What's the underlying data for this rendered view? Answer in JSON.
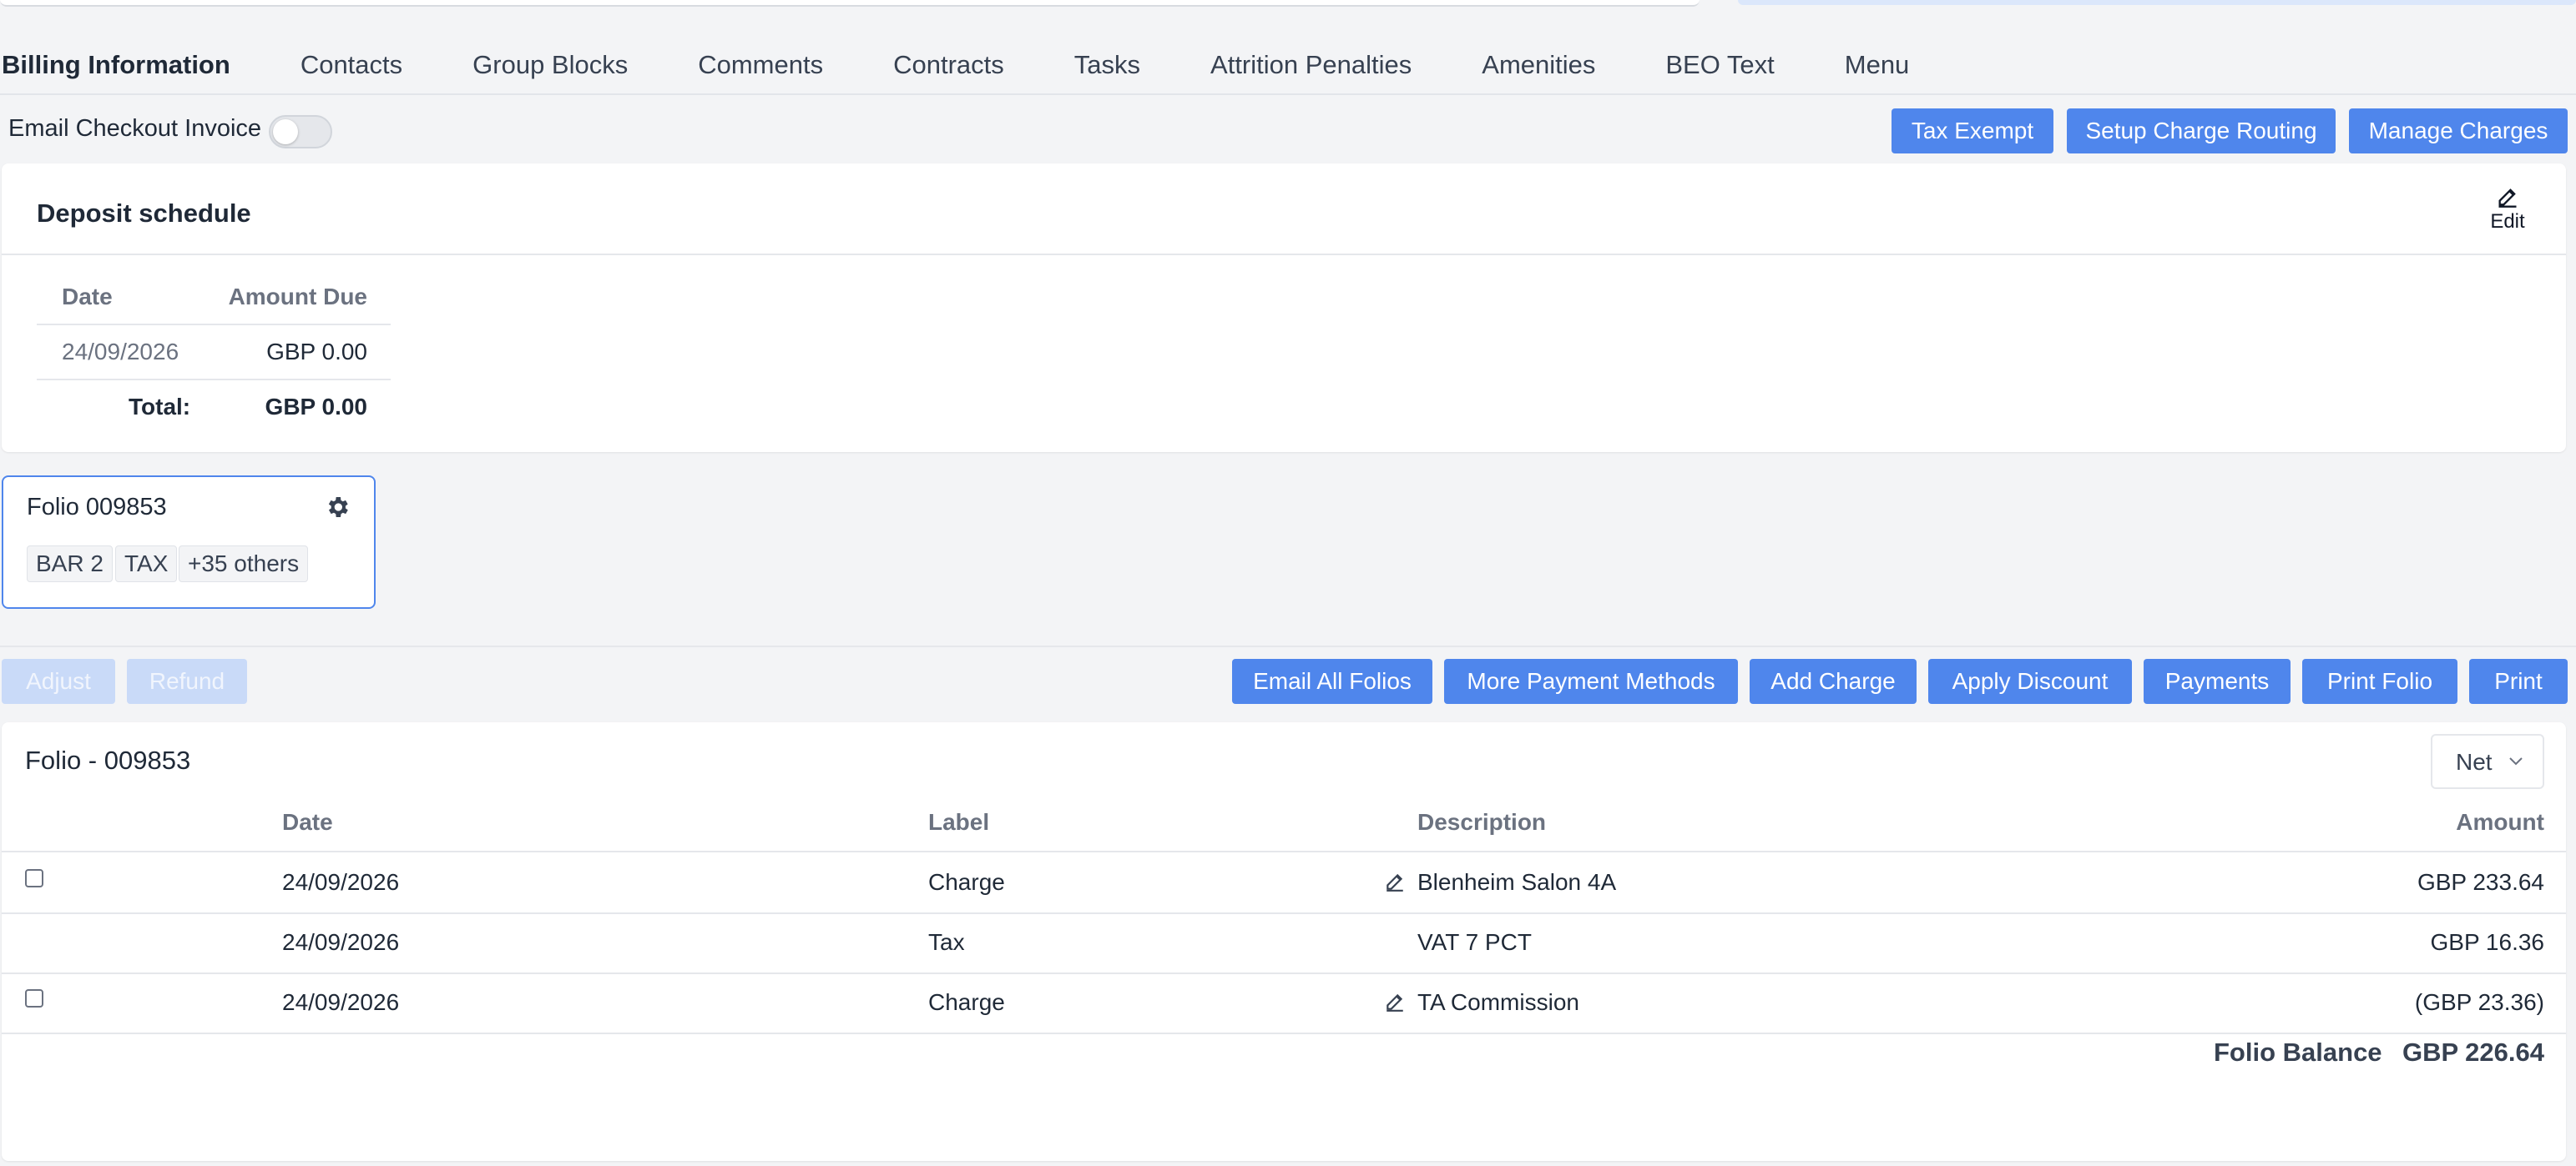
{
  "tabs": [
    "Billing Information",
    "Contacts",
    "Group Blocks",
    "Comments",
    "Contracts",
    "Tasks",
    "Attrition Penalties",
    "Amenities",
    "BEO Text",
    "Menu"
  ],
  "toolbar": {
    "email_checkout_label": "Email Checkout Invoice",
    "email_checkout_enabled": false,
    "buttons": [
      "Tax Exempt",
      "Setup Charge Routing",
      "Manage Charges"
    ]
  },
  "deposit": {
    "title": "Deposit schedule",
    "edit_label": "Edit",
    "columns": [
      "Date",
      "Amount Due"
    ],
    "rows": [
      {
        "date": "24/09/2026",
        "amount": "GBP 0.00"
      }
    ],
    "total_label": "Total:",
    "total_value": "GBP 0.00"
  },
  "folio_summary": {
    "title": "Folio 009853",
    "chips": [
      "BAR 2",
      "TAX",
      "+35 others"
    ]
  },
  "actions": {
    "left": [
      "Adjust",
      "Refund"
    ],
    "right": [
      "Email All Folios",
      "More Payment Methods",
      "Add Charge",
      "Apply Discount",
      "Payments",
      "Print Folio",
      "Print"
    ]
  },
  "folio": {
    "title": "Folio - 009853",
    "view": "Net",
    "columns": [
      "Date",
      "Label",
      "Description",
      "Amount"
    ],
    "rows": [
      {
        "date": "24/09/2026",
        "label": "Charge",
        "description": "Blenheim Salon 4A",
        "amount": "GBP 233.64"
      },
      {
        "date": "24/09/2026",
        "label": "Tax",
        "description": "VAT 7 PCT",
        "amount": "GBP 16.36"
      },
      {
        "date": "24/09/2026",
        "label": "Charge",
        "description": "TA Commission",
        "amount": "(GBP 23.36)"
      }
    ],
    "balance_label": "Folio Balance",
    "balance_value": "GBP 226.64"
  },
  "colors": {
    "accent": "#4f86ec",
    "accent_disabled": "#c9daf8",
    "background": "#f3f4f6"
  }
}
